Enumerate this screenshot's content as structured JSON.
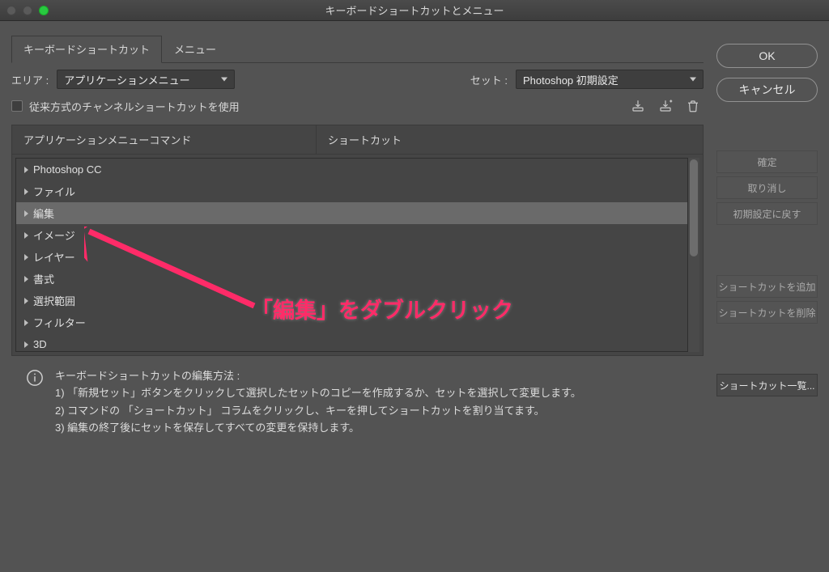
{
  "window": {
    "title": "キーボードショートカットとメニュー"
  },
  "tabs": {
    "shortcuts": "キーボードショートカット",
    "menus": "メニュー"
  },
  "area": {
    "label": "エリア :",
    "value": "アプリケーションメニュー"
  },
  "set": {
    "label": "セット :",
    "value": "Photoshop 初期設定"
  },
  "legacy": {
    "label": "従来方式のチャンネルショートカットを使用"
  },
  "columns": {
    "command": "アプリケーションメニューコマンド",
    "shortcut": "ショートカット"
  },
  "rows": [
    {
      "label": "Photoshop CC"
    },
    {
      "label": "ファイル"
    },
    {
      "label": "編集",
      "selected": true
    },
    {
      "label": "イメージ"
    },
    {
      "label": "レイヤー"
    },
    {
      "label": "書式"
    },
    {
      "label": "選択範囲"
    },
    {
      "label": "フィルター"
    },
    {
      "label": "3D"
    }
  ],
  "buttons": {
    "ok": "OK",
    "cancel": "キャンセル",
    "accept": "確定",
    "undo": "取り消し",
    "reset": "初期設定に戻す",
    "add": "ショートカットを追加",
    "delete": "ショートカットを削除",
    "summary": "ショートカット一覧..."
  },
  "help": {
    "title": "キーボードショートカットの編集方法 :",
    "l1": "1) 「新規セット」ボタンをクリックして選択したセットのコピーを作成するか、セットを選択して変更します。",
    "l2": "2) コマンドの 「ショートカット」 コラムをクリックし、キーを押してショートカットを割り当てます。",
    "l3": "3) 編集の終了後にセットを保存してすべての変更を保持します。"
  },
  "annotation": "「編集」をダブルクリック"
}
